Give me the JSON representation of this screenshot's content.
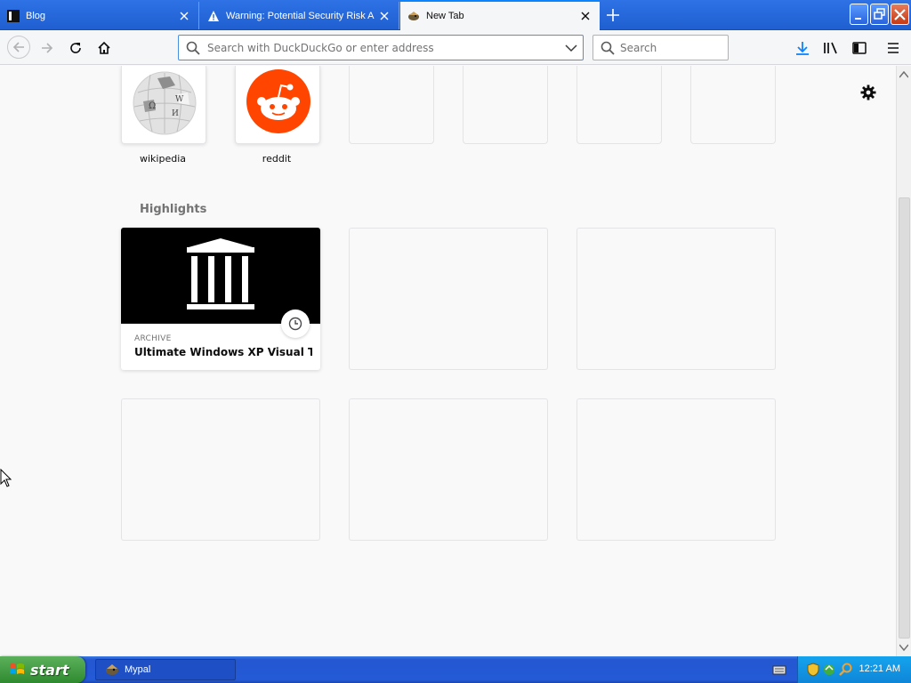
{
  "tabs": [
    {
      "title": "Blog",
      "favicon": "blog-favicon-icon",
      "active": false
    },
    {
      "title": "Warning: Potential Security Risk A",
      "favicon": "warning-icon",
      "active": false
    },
    {
      "title": "New Tab",
      "favicon": "mypal-favicon-icon",
      "active": true
    }
  ],
  "navbar": {
    "url_placeholder": "Search with DuckDuckGo or enter address",
    "search_placeholder": "Search"
  },
  "top_sites": [
    {
      "label": "wikipedia",
      "icon": "wikipedia-logo-icon"
    },
    {
      "label": "reddit",
      "icon": "reddit-logo-icon"
    },
    {
      "label": ""
    },
    {
      "label": ""
    },
    {
      "label": ""
    },
    {
      "label": ""
    }
  ],
  "highlights": {
    "title": "Highlights",
    "card": {
      "source": "ARCHIVE",
      "title": "Ultimate Windows XP Visual The...",
      "image_icon": "archive-building-icon"
    }
  },
  "taskbar": {
    "start_label": "start",
    "task_label": "Mypal",
    "clock": "12:21 AM"
  },
  "colors": {
    "accent": "#0a84ff",
    "reddit": "#ff4500",
    "taskbar": "#245ad6",
    "start_green": "#3c9a3c"
  }
}
